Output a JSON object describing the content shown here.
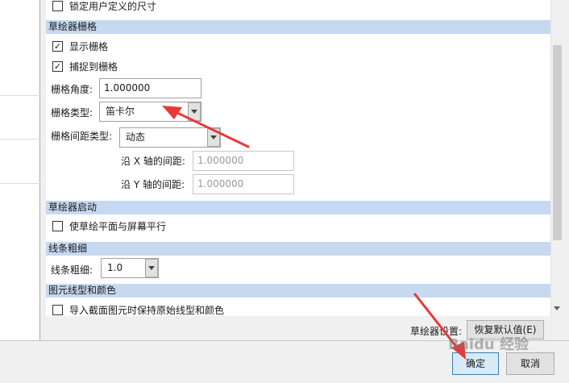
{
  "sections": {
    "top": {
      "lock_user_size": {
        "label": "锁定用户定义的尺寸",
        "checked": false
      }
    },
    "grid": {
      "header": "草绘器栅格",
      "show_grid": {
        "label": "显示栅格",
        "checked": true
      },
      "snap_grid": {
        "label": "捕捉到栅格",
        "checked": true
      },
      "angle": {
        "label": "栅格角度:",
        "value": "1.000000"
      },
      "type": {
        "label": "栅格类型:",
        "value": "笛卡尔"
      },
      "spacing_type": {
        "label": "栅格间距类型:",
        "value": "动态"
      },
      "x_spacing": {
        "label": "沿 X 轴的间距:",
        "value": "1.000000"
      },
      "y_spacing": {
        "label": "沿 Y 轴的间距:",
        "value": "1.000000"
      }
    },
    "startup": {
      "header": "草绘器启动",
      "parallel": {
        "label": "使草绘平面与屏幕平行",
        "checked": false
      }
    },
    "line_weight": {
      "header": "线条粗细",
      "label": "线条粗细:",
      "value": "1.0"
    },
    "entity": {
      "header": "图元线型和颜色",
      "keep_original": {
        "label": "导入截面图元时保持原始线型和颜色",
        "checked": false
      }
    }
  },
  "footer": {
    "settings_label": "草绘器设置:",
    "restore_default": "恢复默认值(E)",
    "ok": "确定",
    "cancel": "取消"
  },
  "watermark": "Baidu 经验",
  "colors": {
    "section_header": "#c6d9f1",
    "annotation_arrow": "#e8393a"
  },
  "icons": {
    "check": "✓",
    "dropdown": "chevron-down-icon"
  }
}
